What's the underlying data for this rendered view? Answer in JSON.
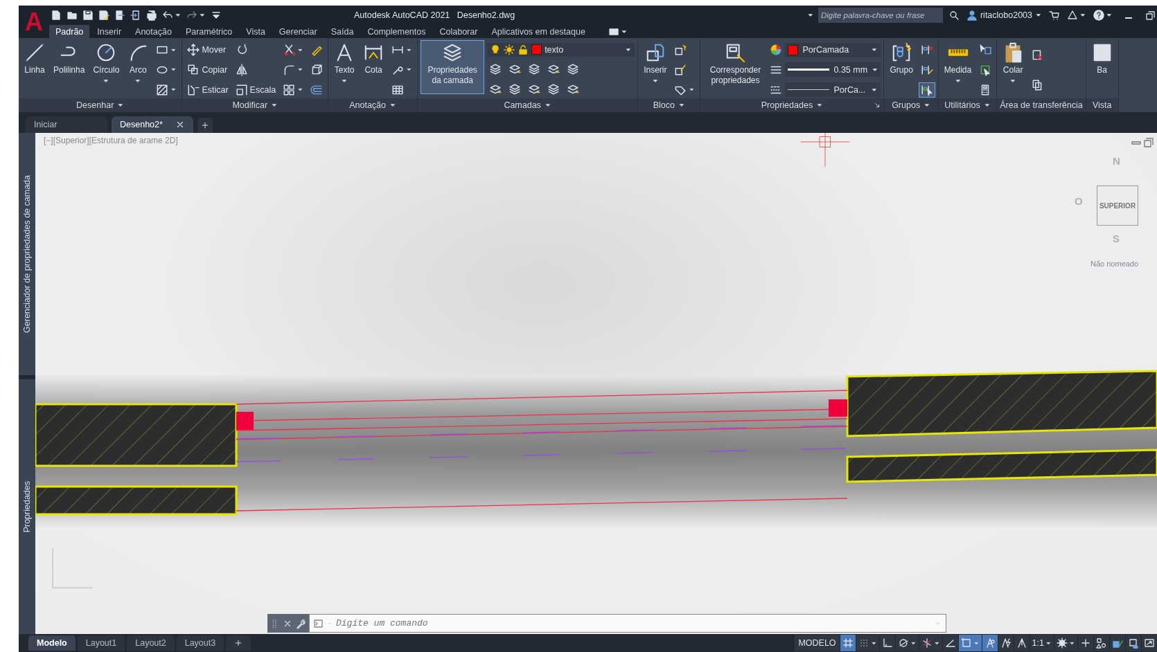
{
  "logo": "A",
  "title": {
    "app": "Autodesk AutoCAD 2021",
    "file": "Desenho2.dwg"
  },
  "search": {
    "placeholder": "Digite palavra-chave ou frase"
  },
  "user": {
    "name": "ritaclobo2003"
  },
  "ribbon_tabs": [
    {
      "label": "Padrão",
      "selected": true
    },
    {
      "label": "Inserir",
      "selected": false
    },
    {
      "label": "Anotação",
      "selected": false
    },
    {
      "label": "Paramétrico",
      "selected": false
    },
    {
      "label": "Vista",
      "selected": false
    },
    {
      "label": "Gerenciar",
      "selected": false
    },
    {
      "label": "Saída",
      "selected": false
    },
    {
      "label": "Complementos",
      "selected": false
    },
    {
      "label": "Colaborar",
      "selected": false
    },
    {
      "label": "Aplicativos em destaque",
      "selected": false
    }
  ],
  "panels": [
    {
      "title": "Desenhar",
      "menu": true,
      "launcher": false,
      "columns": [
        {
          "kind": "large",
          "items": [
            {
              "label": "Linha",
              "kind": "line",
              "menu": false,
              "active": false
            }
          ]
        },
        {
          "kind": "large",
          "items": [
            {
              "label": "Polilinha",
              "kind": "polyline",
              "menu": false,
              "active": false
            }
          ]
        },
        {
          "kind": "large",
          "items": [
            {
              "label": "Círculo",
              "kind": "circle",
              "menu": true,
              "active": false
            }
          ]
        },
        {
          "kind": "large",
          "items": [
            {
              "label": "Arco",
              "kind": "arc",
              "menu": true,
              "active": false
            }
          ]
        },
        {
          "kind": "small",
          "items": [
            {
              "kind": "rectangle",
              "menu": true,
              "active": false
            },
            {
              "kind": "ellipse",
              "menu": true,
              "active": false
            },
            {
              "kind": "hatch",
              "menu": true,
              "active": false
            }
          ]
        }
      ]
    },
    {
      "title": "Modificar",
      "menu": true,
      "launcher": false,
      "columns": [
        {
          "kind": "small",
          "items": [
            {
              "label": "Mover",
              "kind": "move",
              "menu": false,
              "active": false
            },
            {
              "label": "Copiar",
              "kind": "copy",
              "menu": false,
              "active": false
            },
            {
              "label": "Esticar",
              "kind": "stretch",
              "menu": false,
              "active": false
            }
          ]
        },
        {
          "kind": "small",
          "items": [
            {
              "kind": "rotate",
              "menu": false,
              "active": false
            },
            {
              "kind": "mirror",
              "menu": false,
              "active": false
            },
            {
              "label": "Escala",
              "kind": "scale",
              "menu": false,
              "active": false
            }
          ]
        },
        {
          "kind": "small",
          "items": [
            {
              "kind": "trim",
              "menu": true,
              "active": false
            },
            {
              "kind": "fillet",
              "menu": true,
              "active": false
            },
            {
              "kind": "array",
              "menu": true,
              "active": false
            }
          ]
        },
        {
          "kind": "small",
          "items": [
            {
              "kind": "eraser",
              "menu": false,
              "active": false
            },
            {
              "kind": "box",
              "menu": false,
              "active": false
            },
            {
              "kind": "offset",
              "menu": false,
              "active": false
            }
          ]
        }
      ]
    },
    {
      "title": "Anotação",
      "menu": true,
      "launcher": false,
      "columns": [
        {
          "kind": "large",
          "items": [
            {
              "label": "Texto",
              "kind": "text",
              "menu": true,
              "active": false
            }
          ]
        },
        {
          "kind": "large",
          "items": [
            {
              "label": "Cota",
              "kind": "dimension",
              "menu": false,
              "active": false
            }
          ]
        },
        {
          "kind": "small",
          "items": [
            {
              "kind": "linear-dimension",
              "menu": true,
              "active": false
            },
            {
              "kind": "leader",
              "menu": true,
              "active": false
            },
            {
              "kind": "table",
              "menu": false,
              "active": false
            }
          ]
        }
      ]
    },
    {
      "title": "Camadas",
      "menu": true,
      "launcher": false,
      "columns": [
        {
          "kind": "large",
          "items": [
            {
              "label": "Propriedades da camada",
              "kind": "layers",
              "menu": false,
              "active": true
            }
          ]
        },
        {
          "kind": "layer",
          "layer": {
            "name": "texto",
            "color": "#ff0000"
          }
        }
      ]
    },
    {
      "title": "Bloco",
      "menu": true,
      "launcher": false,
      "columns": [
        {
          "kind": "large",
          "items": [
            {
              "label": "Inserir",
              "kind": "insert",
              "menu": true,
              "active": false
            }
          ]
        },
        {
          "kind": "small",
          "items": [
            {
              "kind": "block-create",
              "menu": false,
              "active": false
            },
            {
              "kind": "block-edit",
              "menu": false,
              "active": false
            },
            {
              "kind": "attribute",
              "menu": true,
              "active": false
            }
          ]
        }
      ]
    },
    {
      "title": "Propriedades",
      "menu": true,
      "launcher": true,
      "columns": [
        {
          "kind": "large",
          "items": [
            {
              "label": "Corresponder propriedades",
              "kind": "match",
              "menu": false,
              "active": false
            }
          ]
        },
        {
          "kind": "properties",
          "items": [
            {
              "kind": "color",
              "value": "PorCamada",
              "color": "#ff0000"
            },
            {
              "kind": "lineweight",
              "value": "0.35 mm"
            },
            {
              "kind": "linetype",
              "value": "PorCa..."
            }
          ]
        }
      ]
    },
    {
      "title": "Grupos",
      "menu": true,
      "launcher": false,
      "columns": [
        {
          "kind": "large",
          "items": [
            {
              "label": "Grupo",
              "kind": "group",
              "menu": false,
              "active": false
            }
          ]
        },
        {
          "kind": "small",
          "items": [
            {
              "kind": "ungroup",
              "menu": false,
              "active": false
            },
            {
              "kind": "group-edit",
              "menu": false,
              "active": false
            },
            {
              "kind": "group-select",
              "menu": false,
              "active": true
            }
          ]
        }
      ]
    },
    {
      "title": "Utilitários",
      "menu": true,
      "launcher": false,
      "columns": [
        {
          "kind": "large",
          "items": [
            {
              "label": "Medida",
              "kind": "ruler",
              "menu": true,
              "active": false
            }
          ]
        },
        {
          "kind": "small",
          "items": [
            {
              "kind": "quick-select",
              "menu": false,
              "active": false
            },
            {
              "kind": "select-all",
              "menu": false,
              "active": false
            },
            {
              "kind": "calculator",
              "menu": false,
              "active": false
            }
          ]
        }
      ]
    },
    {
      "title": "Área de transferência",
      "menu": false,
      "launcher": false,
      "columns": [
        {
          "kind": "large",
          "items": [
            {
              "label": "Colar",
              "kind": "paste",
              "menu": true,
              "active": false
            }
          ]
        },
        {
          "kind": "small",
          "items": [
            {
              "kind": "cut",
              "menu": false,
              "active": false
            },
            {
              "kind": "copy-clip",
              "menu": false,
              "active": false
            }
          ]
        }
      ]
    },
    {
      "title": "Vista",
      "menu": false,
      "launcher": false,
      "columns": [
        {
          "kind": "large",
          "items": [
            {
              "label": "Ba",
              "kind": "view-box",
              "menu": false,
              "active": false
            }
          ]
        }
      ]
    }
  ],
  "doc_tabs": [
    {
      "label": "Iniciar",
      "selected": false
    },
    {
      "label": "Desenho2*",
      "selected": true
    }
  ],
  "palettes": [
    {
      "label": "Gerenciador de propriedades de camada"
    },
    {
      "label": "Propriedades"
    }
  ],
  "viewport_label": "[−][Superior][Estrutura de arame 2D]",
  "viewcube": {
    "north": "N",
    "south": "S",
    "west": "O",
    "face": "SUPERIOR",
    "named_view": "Não nomeado"
  },
  "command_line": {
    "placeholder": "Digite um comando"
  },
  "layout_tabs": [
    {
      "label": "Modelo",
      "selected": true
    },
    {
      "label": "Layout1",
      "selected": false
    },
    {
      "label": "Layout2",
      "selected": false
    },
    {
      "label": "Layout3",
      "selected": false
    }
  ],
  "status": {
    "space": "MODELO",
    "scale": "1:1",
    "toggles": [
      {
        "kind": "grid",
        "on": true,
        "menu": false
      },
      {
        "kind": "snap",
        "on": false,
        "menu": true
      },
      {
        "kind": "ortho",
        "on": false,
        "menu": false
      },
      {
        "kind": "polar",
        "on": false,
        "menu": true
      },
      {
        "kind": "isodraft",
        "on": false,
        "menu": true
      },
      {
        "kind": "tracking",
        "on": false,
        "menu": false
      },
      {
        "kind": "osnap",
        "on": true,
        "menu": true
      },
      {
        "kind": "anno-visible",
        "on": true,
        "menu": false
      },
      {
        "kind": "anno-auto",
        "on": false,
        "menu": false
      },
      {
        "kind": "anno-scale",
        "on": false,
        "menu": false
      }
    ],
    "tools": [
      {
        "kind": "gear",
        "menu": true
      },
      {
        "kind": "plus",
        "menu": false
      },
      {
        "kind": "isolate",
        "menu": false
      },
      {
        "kind": "hardware",
        "menu": false
      },
      {
        "kind": "clean-screen",
        "menu": false
      },
      {
        "kind": "fullscreen",
        "menu": false
      }
    ]
  }
}
